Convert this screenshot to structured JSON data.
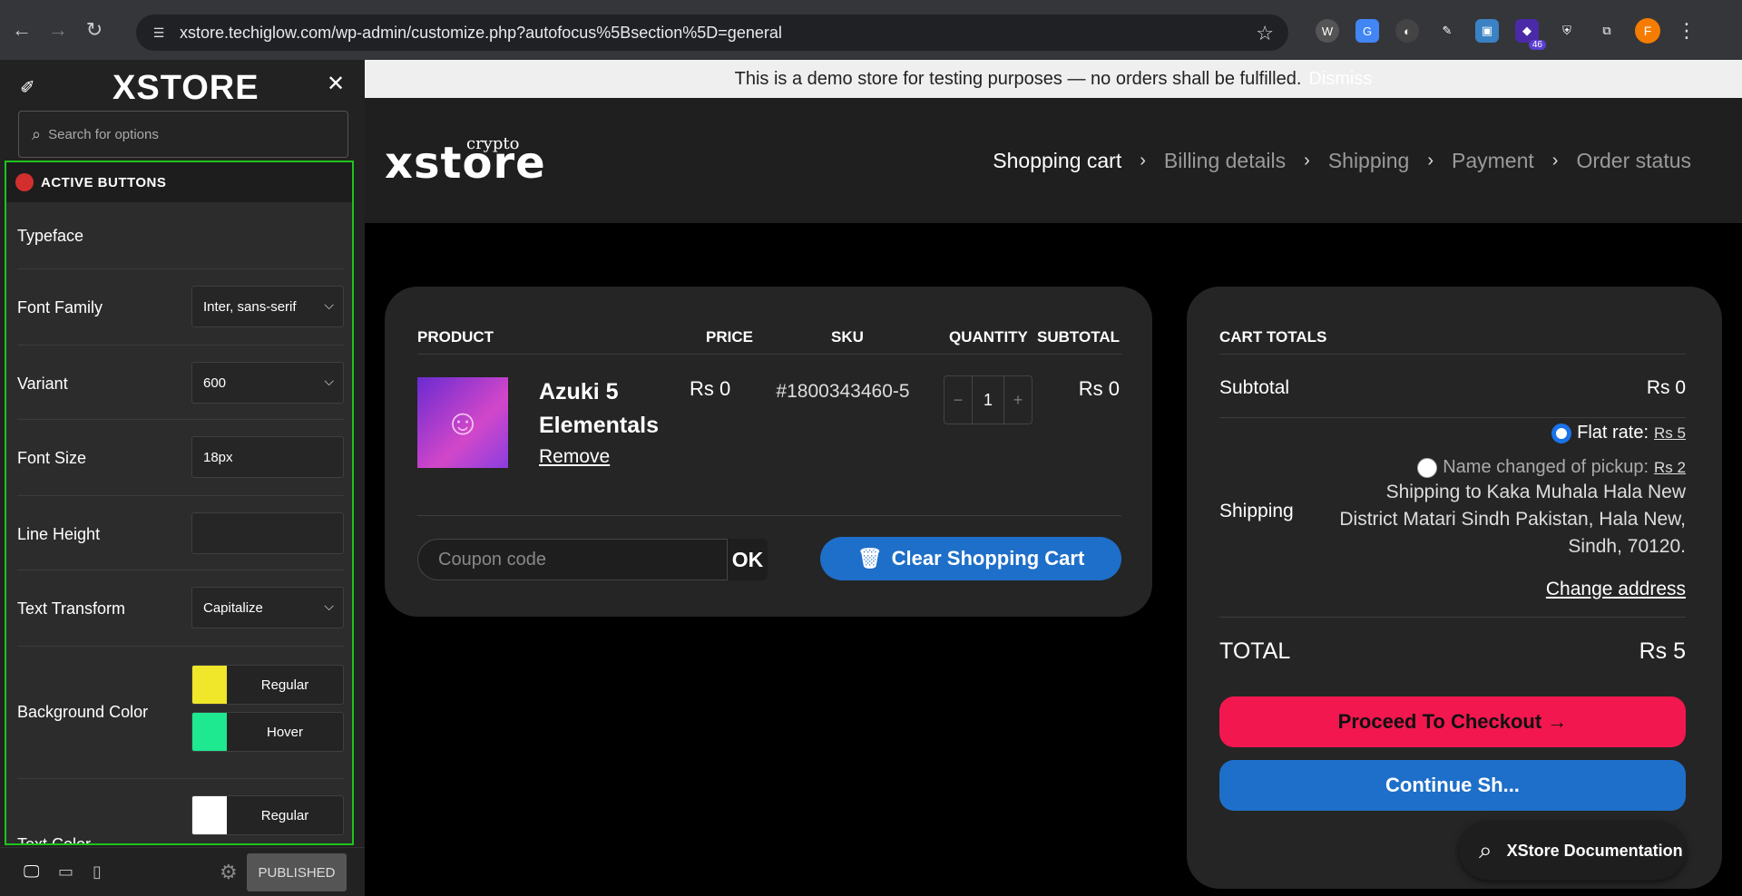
{
  "browser": {
    "back_icon": "arrow-left-icon",
    "url": "xstore.techiglow.com/wp-admin/customize.php?autofocus%5Bsection%5D=general",
    "avatar_letter": "F",
    "extension_badge": "46"
  },
  "customizer": {
    "logo": "XSTORE",
    "search_placeholder": "Search for options",
    "section_title": "ACTIVE BUTTONS",
    "typeface_label": "Typeface",
    "font_family_label": "Font Family",
    "font_family_value": "Inter, sans-serif",
    "variant_label": "Variant",
    "variant_value": "600",
    "font_size_label": "Font Size",
    "font_size_value": "18px",
    "line_height_label": "Line Height",
    "line_height_value": "",
    "text_transform_label": "Text Transform",
    "text_transform_value": "Capitalize",
    "bg_color_label": "Background Color",
    "bg_regular_label": "Regular",
    "bg_regular_color": "#f0e62a",
    "bg_hover_label": "Hover",
    "bg_hover_color": "#1ee890",
    "text_color_label": "Text Color",
    "text_regular_label": "Regular",
    "text_regular_color": "#ffffff",
    "published_label": "PUBLISHED"
  },
  "site": {
    "notice": "This is a demo store for testing purposes — no orders shall be fulfilled.",
    "notice_dismiss": "Dismiss",
    "logo": "xstore",
    "logo_sup": "crypto",
    "steps": [
      "Shopping cart",
      "Billing details",
      "Shipping",
      "Payment",
      "Order status"
    ]
  },
  "cart": {
    "headers": {
      "product": "PRODUCT",
      "price": "PRICE",
      "sku": "SKU",
      "quantity": "QUANTITY",
      "subtotal": "SUBTOTAL"
    },
    "item": {
      "name": "Azuki 5 Elementals",
      "remove": "Remove",
      "price": "Rs 0",
      "sku": "#1800343460-5",
      "quantity": "1",
      "subtotal": "Rs 0"
    },
    "coupon_placeholder": "Coupon code",
    "ok_label": "OK",
    "clear_label": "Clear Shopping Cart"
  },
  "totals": {
    "title": "CART TOTALS",
    "subtotal_label": "Subtotal",
    "subtotal_value": "Rs 0",
    "flat_rate_label": "Flat rate:",
    "flat_rate_price": "Rs 5",
    "pickup_label": "Name changed of pickup:",
    "pickup_price": "Rs 2",
    "shipping_label": "Shipping",
    "shipping_address": "Shipping to Kaka Muhala Hala New District Matari Sindh Pakistan, Hala New, Sindh, 70120.",
    "change_address": "Change address",
    "total_label": "TOTAL",
    "total_value": "Rs 5",
    "checkout_label": "Proceed To Checkout →",
    "continue_label": "Continue Sh..."
  },
  "doc_widget": {
    "label": "XStore Documentation"
  }
}
